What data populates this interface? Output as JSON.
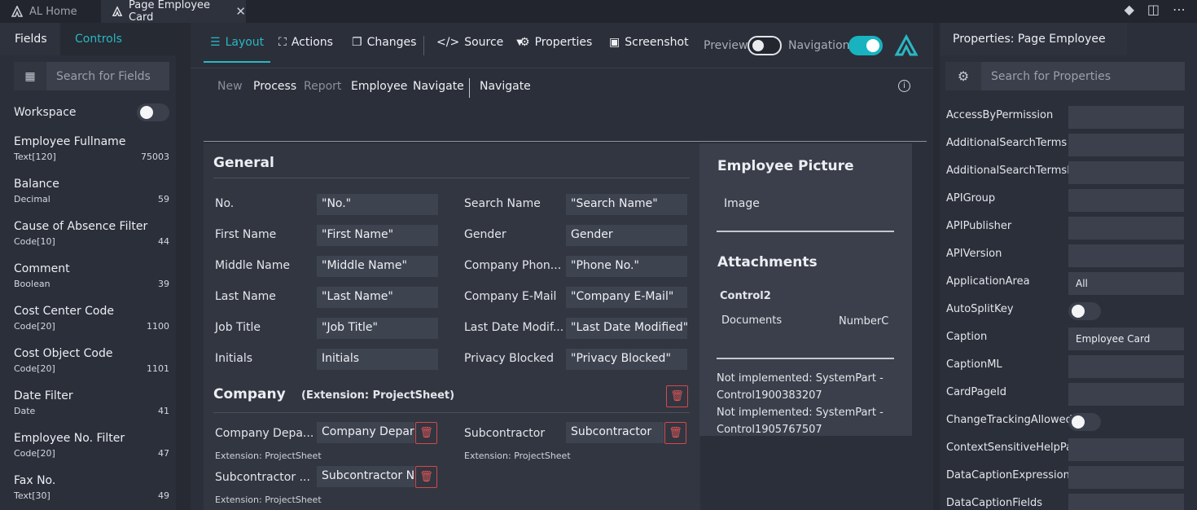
{
  "tabs": [
    {
      "label": "AL Home"
    },
    {
      "label": "Page Employee Card"
    }
  ],
  "left_panel": {
    "tabs": [
      "Fields",
      "Controls"
    ],
    "search_placeholder": "Search for Fields",
    "workspace_label": "Workspace",
    "fields": [
      {
        "name": "Employee Fullname",
        "type": "Text[120]",
        "id": "75003"
      },
      {
        "name": "Balance",
        "type": "Decimal",
        "id": "59"
      },
      {
        "name": "Cause of Absence Filter",
        "type": "Code[10]",
        "id": "44"
      },
      {
        "name": "Comment",
        "type": "Boolean",
        "id": "39"
      },
      {
        "name": "Cost Center Code",
        "type": "Code[20]",
        "id": "1100"
      },
      {
        "name": "Cost Object Code",
        "type": "Code[20]",
        "id": "1101"
      },
      {
        "name": "Date Filter",
        "type": "Date",
        "id": "41"
      },
      {
        "name": "Employee No. Filter",
        "type": "Code[20]",
        "id": "47"
      },
      {
        "name": "Fax No.",
        "type": "Text[30]",
        "id": "49"
      }
    ]
  },
  "toolbar": {
    "layout": "Layout",
    "actions": "Actions",
    "changes": "Changes",
    "source": "Source",
    "properties": "Properties",
    "screenshot": "Screenshot",
    "preview": "Preview",
    "navigation": "Navigation"
  },
  "actionbar": {
    "items": [
      "New",
      "Process",
      "Report",
      "Employee",
      "Navigate",
      "Navigate"
    ]
  },
  "general": {
    "title": "General",
    "left": [
      {
        "label": "No.",
        "value": "\"No.\""
      },
      {
        "label": "First Name",
        "value": "\"First Name\""
      },
      {
        "label": "Middle Name",
        "value": "\"Middle Name\""
      },
      {
        "label": "Last Name",
        "value": "\"Last Name\""
      },
      {
        "label": "Job Title",
        "value": "\"Job Title\""
      },
      {
        "label": "Initials",
        "value": "Initials"
      }
    ],
    "right": [
      {
        "label": "Search Name",
        "value": "\"Search Name\""
      },
      {
        "label": "Gender",
        "value": "Gender"
      },
      {
        "label": "Company Phon...",
        "value": "\"Phone No.\""
      },
      {
        "label": "Company E-Mail",
        "value": "\"Company E-Mail\""
      },
      {
        "label": "Last Date Modif...",
        "value": "\"Last Date Modified\""
      },
      {
        "label": "Privacy Blocked",
        "value": "\"Privacy Blocked\""
      }
    ]
  },
  "company": {
    "title": "Company",
    "subtitle": "(Extension: ProjectSheet)",
    "fields": [
      {
        "label": "Company Depa...",
        "value": "Company Departm",
        "ext": "Extension: ProjectSheet"
      },
      {
        "label": "Subcontractor",
        "value": "Subcontractor",
        "ext": "Extension: ProjectSheet"
      },
      {
        "label": "Subcontractor ...",
        "value": "Subcontractor No.",
        "ext": "Extension: ProjectSheet"
      }
    ]
  },
  "factbox": {
    "picture_title": "Employee Picture",
    "picture_field": "Image",
    "attach_title": "Attachments",
    "control": "Control2",
    "documents": "Documents",
    "number": "NumberC",
    "not_impl_1": "Not implemented: SystemPart - Control1900383207",
    "not_impl_2": "Not implemented: SystemPart - Control1905767507"
  },
  "right_panel": {
    "title": "Properties: Page Employee Card",
    "search_placeholder": "Search for Properties",
    "properties": [
      {
        "name": "AccessByPermission",
        "value": ""
      },
      {
        "name": "AdditionalSearchTerms",
        "value": ""
      },
      {
        "name": "AdditionalSearchTermsML",
        "value": ""
      },
      {
        "name": "APIGroup",
        "value": ""
      },
      {
        "name": "APIPublisher",
        "value": ""
      },
      {
        "name": "APIVersion",
        "value": ""
      },
      {
        "name": "ApplicationArea",
        "value": "All"
      },
      {
        "name": "AutoSplitKey",
        "value": "toggle"
      },
      {
        "name": "Caption",
        "value": "Employee Card"
      },
      {
        "name": "CaptionML",
        "value": ""
      },
      {
        "name": "CardPageId",
        "value": ""
      },
      {
        "name": "ChangeTrackingAllowed",
        "value": "toggle"
      },
      {
        "name": "ContextSensitiveHelpPage",
        "value": ""
      },
      {
        "name": "DataCaptionExpression",
        "value": ""
      },
      {
        "name": "DataCaptionFields",
        "value": ""
      }
    ]
  },
  "colors": {
    "accent": "#2ab7c2",
    "danger": "#d5494c"
  }
}
